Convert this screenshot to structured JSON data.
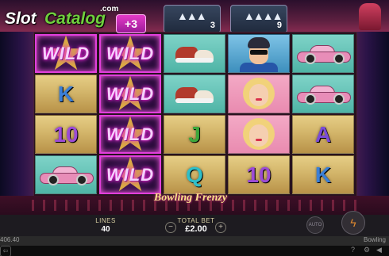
{
  "logo": {
    "slot": "Slot",
    "catalog": "Catalog",
    "com": ".com"
  },
  "multiplier": "+3",
  "pin_counters": [
    {
      "value": "3"
    },
    {
      "value": "9"
    }
  ],
  "reels": [
    [
      "WILD",
      "K",
      "10",
      "car"
    ],
    [
      "WILD",
      "WILD",
      "WILD",
      "WILD"
    ],
    [
      "shoes",
      "shoes",
      "J",
      "Q"
    ],
    [
      "man",
      "woman",
      "woman",
      "10"
    ],
    [
      "car",
      "car",
      "A",
      "K"
    ]
  ],
  "banner": {
    "title": "Bowling Frenzy"
  },
  "controls": {
    "lines_label": "LINES",
    "lines_value": "40",
    "total_bet_label": "TOTAL BET",
    "total_bet_value": "£2.00",
    "minus": "−",
    "plus": "+",
    "auto_label": "AUTO",
    "spin_icon": "lightning-icon"
  },
  "status": {
    "balance": "406.40",
    "game_name": "Bowling"
  },
  "colors": {
    "wild_glow": "#ff2fd1",
    "wood": "#d3b56a",
    "spin_accent": "#e0892f",
    "logo_green": "#6fcf3d"
  }
}
